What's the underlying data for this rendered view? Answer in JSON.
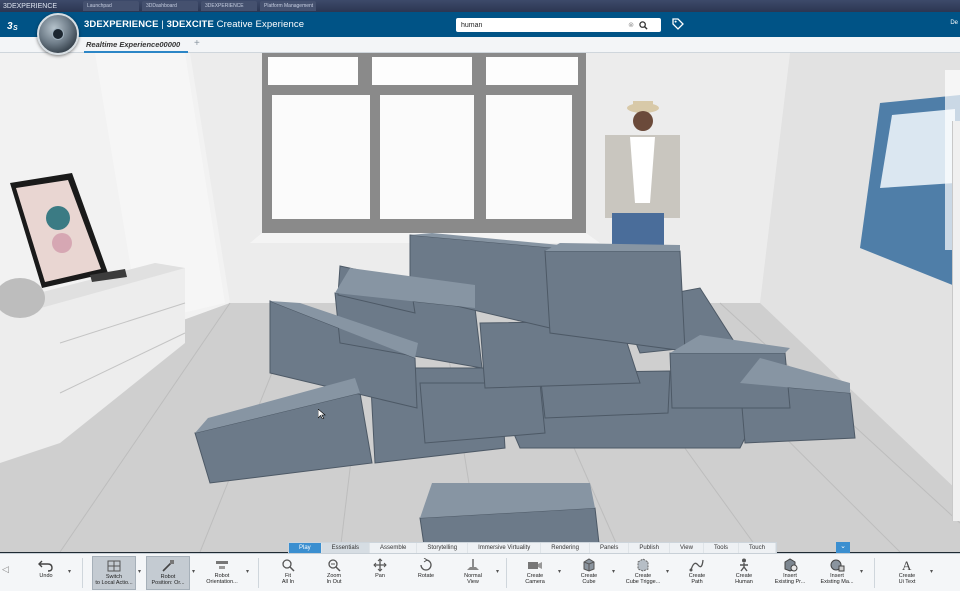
{
  "browser": {
    "window_title": "3DEXPERIENCE",
    "tabs": [
      "Launchpad",
      "3DDashboard",
      "3DEXPERIENCE",
      "Platform Management"
    ]
  },
  "header": {
    "brand": "3DEXPERIENCE",
    "separator": " | ",
    "app_name": "3DEXCITE",
    "app_subtitle": " Creative Experience",
    "search_value": "human",
    "user_short": "De"
  },
  "doc_tab": {
    "label": "Realtime Experience00000",
    "add": "+"
  },
  "section_tabs": [
    {
      "label": "Play",
      "state": "active"
    },
    {
      "label": "Essentials",
      "state": "selected"
    },
    {
      "label": "Assemble",
      "state": ""
    },
    {
      "label": "Storytelling",
      "state": ""
    },
    {
      "label": "Immersive Virtuality",
      "state": ""
    },
    {
      "label": "Rendering",
      "state": ""
    },
    {
      "label": "Panels",
      "state": ""
    },
    {
      "label": "Publish",
      "state": ""
    },
    {
      "label": "View",
      "state": ""
    },
    {
      "label": "Tools",
      "state": ""
    },
    {
      "label": "Touch",
      "state": ""
    }
  ],
  "tools": [
    {
      "label1": "Undo",
      "label2": "",
      "icon": "undo-icon"
    },
    {
      "label1": "Switch",
      "label2": "to Local Actio...",
      "icon": "switch-icon"
    },
    {
      "label1": "Robot",
      "label2": "Position: Or...",
      "icon": "robot-position-icon"
    },
    {
      "label1": "Robot",
      "label2": "Orientation...",
      "icon": "robot-orientation-icon"
    },
    {
      "label1": "Fit",
      "label2": "All In",
      "icon": "fit-all-icon"
    },
    {
      "label1": "Zoom",
      "label2": "In Out",
      "icon": "zoom-icon"
    },
    {
      "label1": "Pan",
      "label2": "",
      "icon": "pan-icon"
    },
    {
      "label1": "Rotate",
      "label2": "",
      "icon": "rotate-icon"
    },
    {
      "label1": "Normal",
      "label2": "View",
      "icon": "normal-view-icon"
    },
    {
      "label1": "Create",
      "label2": "Camera",
      "icon": "camera-icon"
    },
    {
      "label1": "Create",
      "label2": "Cube",
      "icon": "cube-icon"
    },
    {
      "label1": "Create",
      "label2": "Cube Trigge...",
      "icon": "cube-trigger-icon"
    },
    {
      "label1": "Create",
      "label2": "Path",
      "icon": "path-icon"
    },
    {
      "label1": "Create",
      "label2": "Human",
      "icon": "human-icon"
    },
    {
      "label1": "Insert",
      "label2": "Existing Pr...",
      "icon": "insert-product-icon"
    },
    {
      "label1": "Insert",
      "label2": "Existing Ma...",
      "icon": "insert-material-icon"
    },
    {
      "label1": "Create",
      "label2": "Ui Text",
      "icon": "ui-text-icon"
    }
  ],
  "colors": {
    "header_blue": "#005386",
    "accent_blue": "#3b8fd0",
    "block_slate": "#6c7a89",
    "wall_white": "#efefef"
  }
}
